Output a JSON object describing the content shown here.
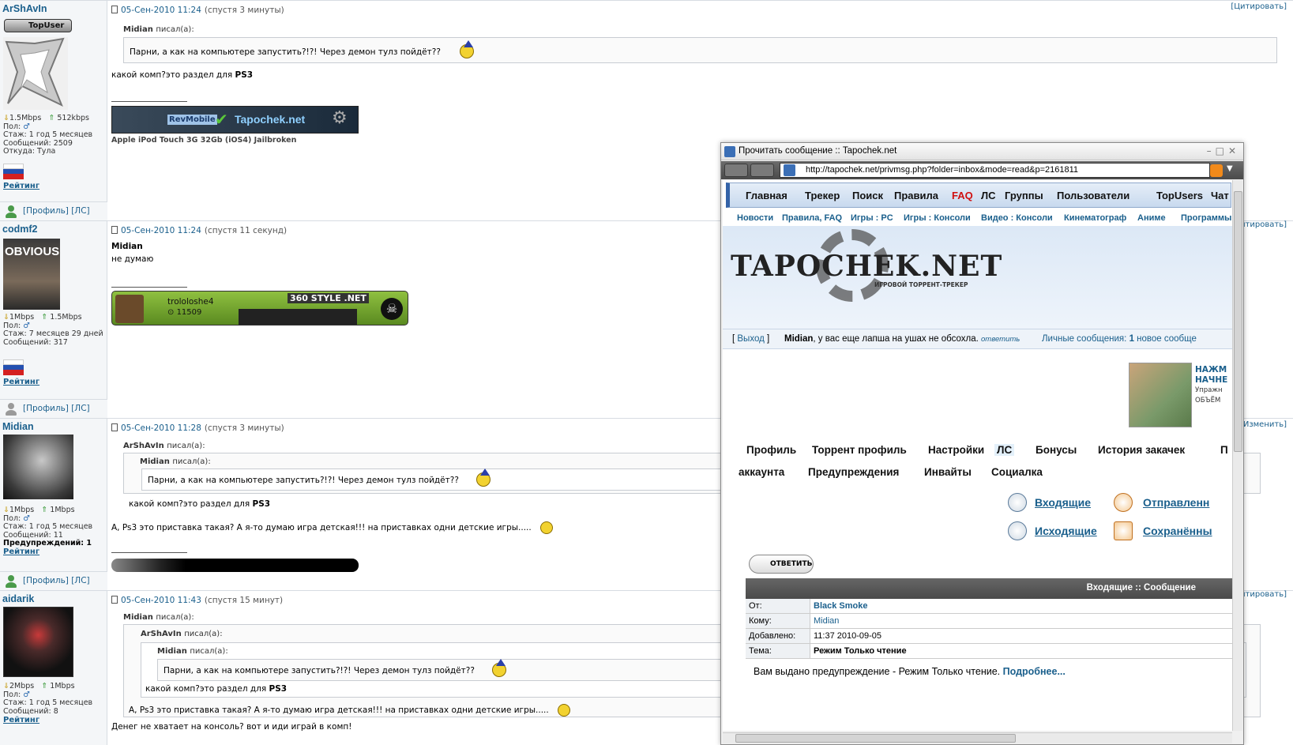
{
  "posts": [
    {
      "author": "ArShAvIn",
      "badge": "TopUser",
      "speed_down": "1.5Mbps",
      "speed_up": "512kbps",
      "gender_label": "Пол:",
      "tenure": "Стаж: 1 год 5 месяцев",
      "messages": "Сообщений: 2509",
      "location": "Откуда: Тула",
      "rating": "Рейтинг",
      "profile_links": "[Профиль]  [ЛС]",
      "date": "05-Сен-2010 11:24",
      "after": "(спустя 3 минуты)",
      "cite": "[Цитировать]",
      "quote_author": "Midian",
      "quote_wrote": "писал(а):",
      "quote_text": "Парни, а как на компьютере запустить?!?! Через демон тулз пойдёт??",
      "text": "какой комп?это раздел для PS3",
      "sig_banner_a": "RevMobile",
      "sig_banner_b": "Tapochek.net",
      "sig_text": "Apple iPod Touch 3G 32Gb (iOS4) Jailbroken"
    },
    {
      "author": "codmf2",
      "avatar_caption": "OBVIOUS",
      "speed_down": "1Mbps",
      "speed_up": "1.5Mbps",
      "gender_label": "Пол:",
      "tenure": "Стаж: 7 месяцев 29 дней",
      "messages": "Сообщений: 317",
      "rating": "Рейтинг",
      "profile_links": "[Профиль]  [ЛС]",
      "date": "05-Сен-2010 11:24",
      "after": "(спустя 11 секунд)",
      "line1": "Midian",
      "line2": "не думаю",
      "sig_user": "trololoshe4",
      "sig_score": "11509",
      "sig_brand": "360 STYLE .NET"
    },
    {
      "author": "Midian",
      "speed_down": "1Mbps",
      "speed_up": "1Mbps",
      "gender_label": "Пол:",
      "tenure": "Стаж: 1 год 5 месяцев",
      "messages": "Сообщений: 11",
      "warnings": "Предупреждений: 1",
      "rating": "Рейтинг",
      "profile_links": "[Профиль]  [ЛС]",
      "date": "05-Сен-2010 11:28",
      "after": "(спустя 3 минуты)",
      "cite": "Изменить]",
      "q1_author": "ArShAvIn",
      "q2_author": "Midian",
      "quote_wrote": "писал(а):",
      "q2_text": "Парни, а как на компьютере запустить?!?! Через демон тулз пойдёт??",
      "q1_text": "какой комп?это раздел для PS3",
      "text": "А, Ps3 это приставка такая? А я-то думаю игра детская!!! на приставках одни детские игры....."
    },
    {
      "author": "aidarik",
      "speed_down": "2Mbps",
      "speed_up": "1Mbps",
      "gender_label": "Пол:",
      "tenure": "Стаж: 1 год 5 месяцев",
      "messages": "Сообщений: 8",
      "rating": "Рейтинг",
      "date": "05-Сен-2010 11:43",
      "after": "(спустя 15 минут)",
      "cite": "итировать]",
      "q1_author": "Midian",
      "q2_author": "ArShAvIn",
      "q3_author": "Midian",
      "quote_wrote": "писал(а):",
      "q3_text": "Парни, а как на компьютере запустить?!?! Через демон тулз пойдёт??",
      "q2_text": "какой комп?это раздел для PS3",
      "q1_text": "А, Ps3 это приставка такая? А я-то думаю игра детская!!! на приставках одни детские игры.....",
      "text": "Денег не хватает на консоль? вот и иди играй в комп!"
    }
  ],
  "side_cites": [
    "итировать]"
  ],
  "popup": {
    "title": "Прочитать сообщение :: Tapochek.net",
    "url": "http://tapochek.net/privmsg.php?folder=inbox&mode=read&p=2161811",
    "topnav": [
      "Главная",
      "Трекер",
      "Поиск",
      "Правила",
      "FAQ",
      "ЛС",
      "Группы",
      "Пользователи",
      "TopUsers",
      "Чат"
    ],
    "faq_color": "#d01010",
    "subnav": [
      "Новости",
      "Правила, FAQ",
      "Игры : PC",
      "Игры : Консоли",
      "Видео : Консоли",
      "Кинематограф",
      "Аниме",
      "Программы"
    ],
    "logo": "TAPOCHEK.NET",
    "logo_sub": "ИГРОВОЙ ТОРРЕНТ-ТРЕКЕР",
    "logout": "Выход",
    "user": "Midian",
    "greeting": ", у вас еще лапша на ушах не обсохла.",
    "reply_link": "ответить",
    "pm_label": "Личные сообщения:",
    "pm_count": "1",
    "pm_new": "новое сообще",
    "ad_line1": "НАЖМ",
    "ad_line2": "НАЧНЕ",
    "ad_line3": "Упражн",
    "ad_line4": "ОБЪЁМ",
    "menu": [
      "Профиль",
      "Торрент профиль",
      "Настройки",
      "ЛС",
      "Бонусы",
      "История закачек",
      "П"
    ],
    "menu2": [
      "аккаунта",
      "Предупреждения",
      "Инвайты",
      "Социалка"
    ],
    "folders": {
      "inbox": "Входящие",
      "sent": "Отправленн",
      "outbox": "Исходящие",
      "saved": "Сохранённы"
    },
    "reply_button": "ОТВЕТИТЬ",
    "msg_header": "Входящие :: Сообщение",
    "fields": [
      {
        "k": "От:",
        "v": "Black Smoke"
      },
      {
        "k": "Кому:",
        "v": "Midian"
      },
      {
        "k": "Добавлено:",
        "v": "11:37 2010-09-05"
      },
      {
        "k": "Тема:",
        "v": "Режим Только чтение"
      }
    ],
    "body": "Вам выдано предупреждение - Режим Только чтение.",
    "more": "Подробнее..."
  }
}
